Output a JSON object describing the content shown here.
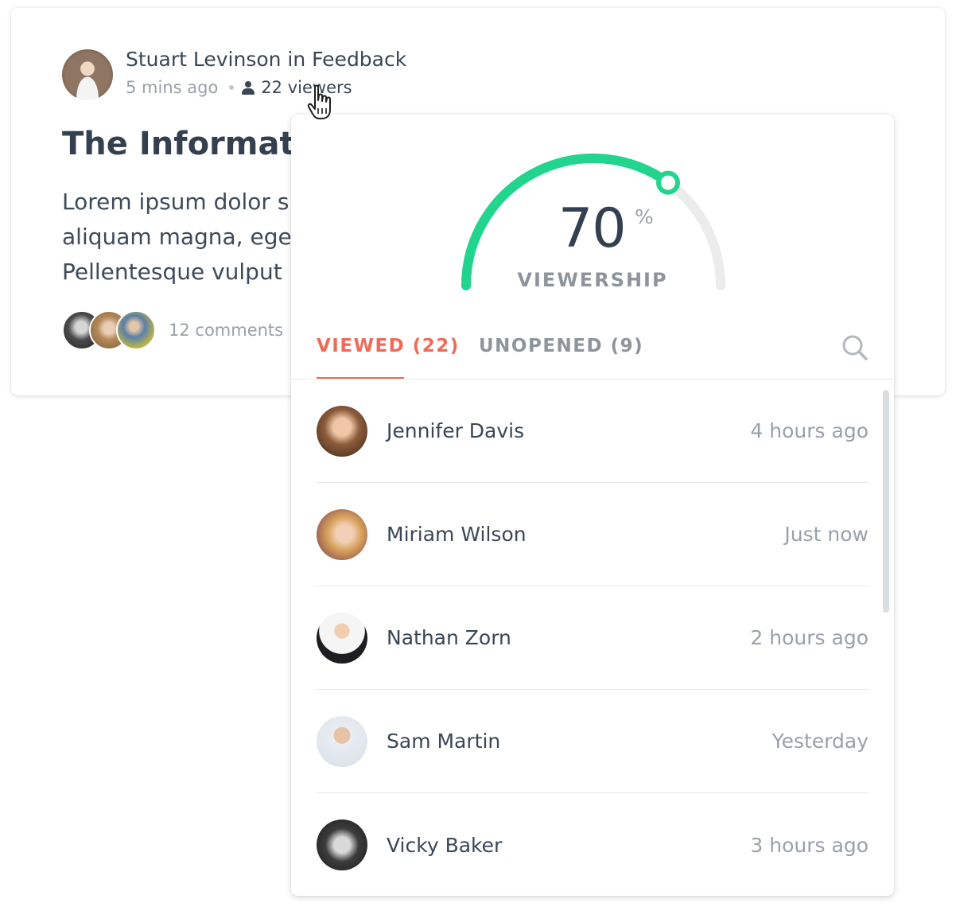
{
  "post": {
    "author_line": "Stuart Levinson in Feedback",
    "time": "5 mins ago",
    "viewers_link": "22 viewers",
    "title": "The Informatio",
    "body_lines": [
      "Lorem ipsum dolor s",
      "aliquam magna, ege",
      "Pellentesque vulput"
    ],
    "comments": "12 comments"
  },
  "popover": {
    "viewership": {
      "value": "70",
      "unit": "%",
      "label": "VIEWERSHIP",
      "fraction": 0.7
    },
    "tabs": {
      "viewed": "VIEWED (22)",
      "unopened": "UNOPENED (9)"
    },
    "viewers": [
      {
        "name": "Jennifer Davis",
        "time": "4 hours ago"
      },
      {
        "name": "Miriam Wilson",
        "time": "Just now"
      },
      {
        "name": "Nathan Zorn",
        "time": "2 hours ago"
      },
      {
        "name": "Sam Martin",
        "time": "Yesterday"
      },
      {
        "name": "Vicky Baker",
        "time": "3 hours ago"
      }
    ]
  },
  "colors": {
    "accent": "#ef6b57",
    "gauge_fill": "#22d58e",
    "gauge_track": "#ececec"
  },
  "icons": [
    "user-icon",
    "hand-cursor-icon",
    "search-icon"
  ]
}
